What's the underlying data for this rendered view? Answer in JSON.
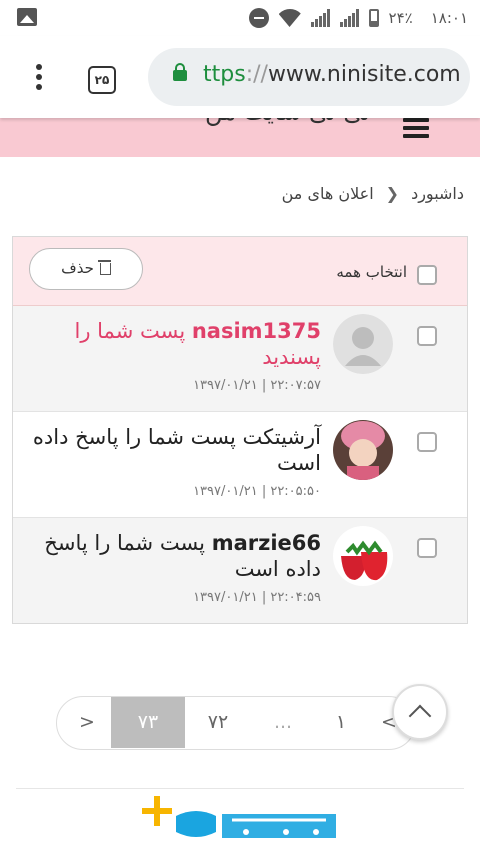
{
  "status_bar": {
    "time": "۱۸:۰۱",
    "battery": "۲۴٪"
  },
  "browser": {
    "tab_count": "۲۵",
    "url_scheme": "ttps",
    "url_sep": "://",
    "url_host": "www.ninisite.com"
  },
  "site": {
    "title": "نی نی سایت من"
  },
  "breadcrumb": {
    "home": "داشبورد",
    "current": "اعلان های من"
  },
  "list_header": {
    "select_all": "انتخاب همه",
    "delete": "حذف"
  },
  "notifications": [
    {
      "user": "nasim1375",
      "text": " پست شما را پسندید",
      "time": "۱۳۹۷/۰۱/۲۱ | ۲۲:۰۷:۵۷"
    },
    {
      "user": "",
      "text": "آرشیتکت پست شما را پاسخ داده است",
      "time": "۱۳۹۷/۰۱/۲۱ | ۲۲:۰۵:۵۰"
    },
    {
      "user": "marzie66",
      "text": " پست شما را پاسخ داده است",
      "time": "۱۳۹۷/۰۱/۲۱ | ۲۲:۰۴:۵۹"
    }
  ],
  "pagination": {
    "prev": ">",
    "first": "۱",
    "ellipsis": "...",
    "p72": "۷۲",
    "current": "۷۳",
    "next": "<"
  },
  "colors": {
    "header_bg": "#f9c9d2",
    "accent_pink": "#e0406a",
    "secure_green": "#1e8e3e"
  }
}
